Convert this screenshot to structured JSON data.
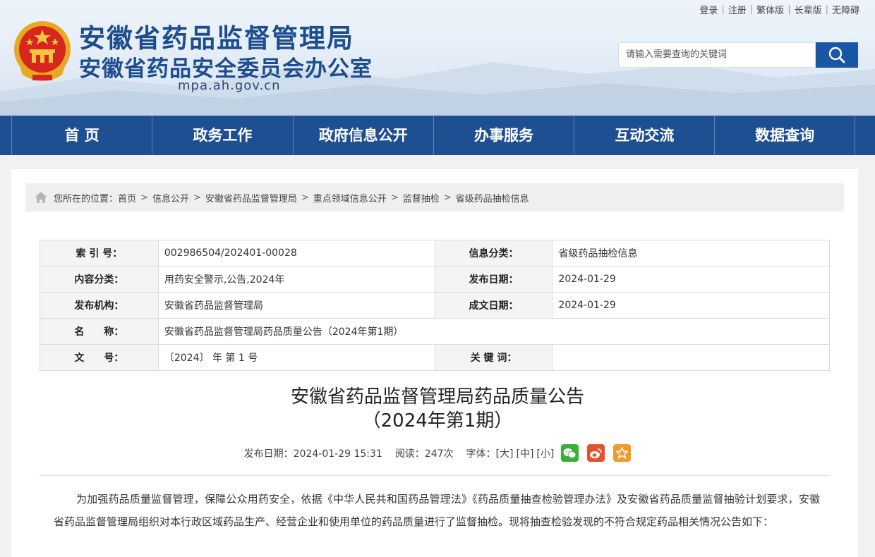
{
  "header": {
    "title_main": "安徽省药品监督管理局",
    "title_sub": "安徽省药品安全委员会办公室",
    "domain": "mpa.ah.gov.cn",
    "top_links": [
      "登录",
      "注册",
      "繁体版",
      "长辈版",
      "无障碍"
    ],
    "search_placeholder": "请输入需要查询的关键词",
    "emblem_icon": "national-emblem-icon",
    "search_icon": "search-icon"
  },
  "nav": [
    "首 页",
    "政务工作",
    "政府信息公开",
    "办事服务",
    "互动交流",
    "数据查询"
  ],
  "breadcrumb": {
    "prefix": "您所在的位置：",
    "items": [
      "首页",
      "信息公开",
      "安徽省药品监督管理局",
      "重点领域信息公开",
      "监督抽检",
      "省级药品抽检信息"
    ]
  },
  "meta": {
    "index_label": "索 引 号：",
    "index_value": "002986504/202401-00028",
    "category_label": "信息分类：",
    "category_value": "省级药品抽检信息",
    "content_label": "内容分类：",
    "content_value": "用药安全警示,公告,2024年",
    "publish_label": "发布日期：",
    "publish_value": "2024-01-29",
    "org_label": "发布机构：",
    "org_value": "安徽省药品监督管理局",
    "created_label": "成文日期：",
    "created_value": "2024-01-29",
    "name_label": "名　　称：",
    "name_value": "安徽省药品监督管理局药品质量公告（2024年第1期）",
    "docno_label": "文　　号：",
    "docno_value": "〔2024〕 年 第 1 号",
    "keywords_label": "关 键 词：",
    "keywords_value": ""
  },
  "article": {
    "title_line1": "安徽省药品监督管理局药品质量公告",
    "title_line2": "（2024年第1期）",
    "publish_info": "发布日期：2024-01-29 15:31",
    "read_info": "阅读：247次",
    "font_label": "字体：",
    "font_large": "[大]",
    "font_medium": "[中]",
    "font_small": "[小]",
    "share_icons": [
      "wechat-icon",
      "weibo-icon",
      "favorite-icon"
    ],
    "paragraph1": "为加强药品质量监督管理，保障公众用药安全，依据《中华人民共和国药品管理法》《药品质量抽查检验管理办法》及安徽省药品质量监督抽验计划要求，安徽省药品监督管理局组织对本行政区域药品生产、经营企业和使用单位的药品质量进行了监督抽检。现将抽查检验发现的不符合规定药品相关情况公告如下："
  },
  "colors": {
    "nav_bg": "#1e4f93",
    "title_blue": "#1d4c8f",
    "search_btn": "#1a56a6"
  }
}
